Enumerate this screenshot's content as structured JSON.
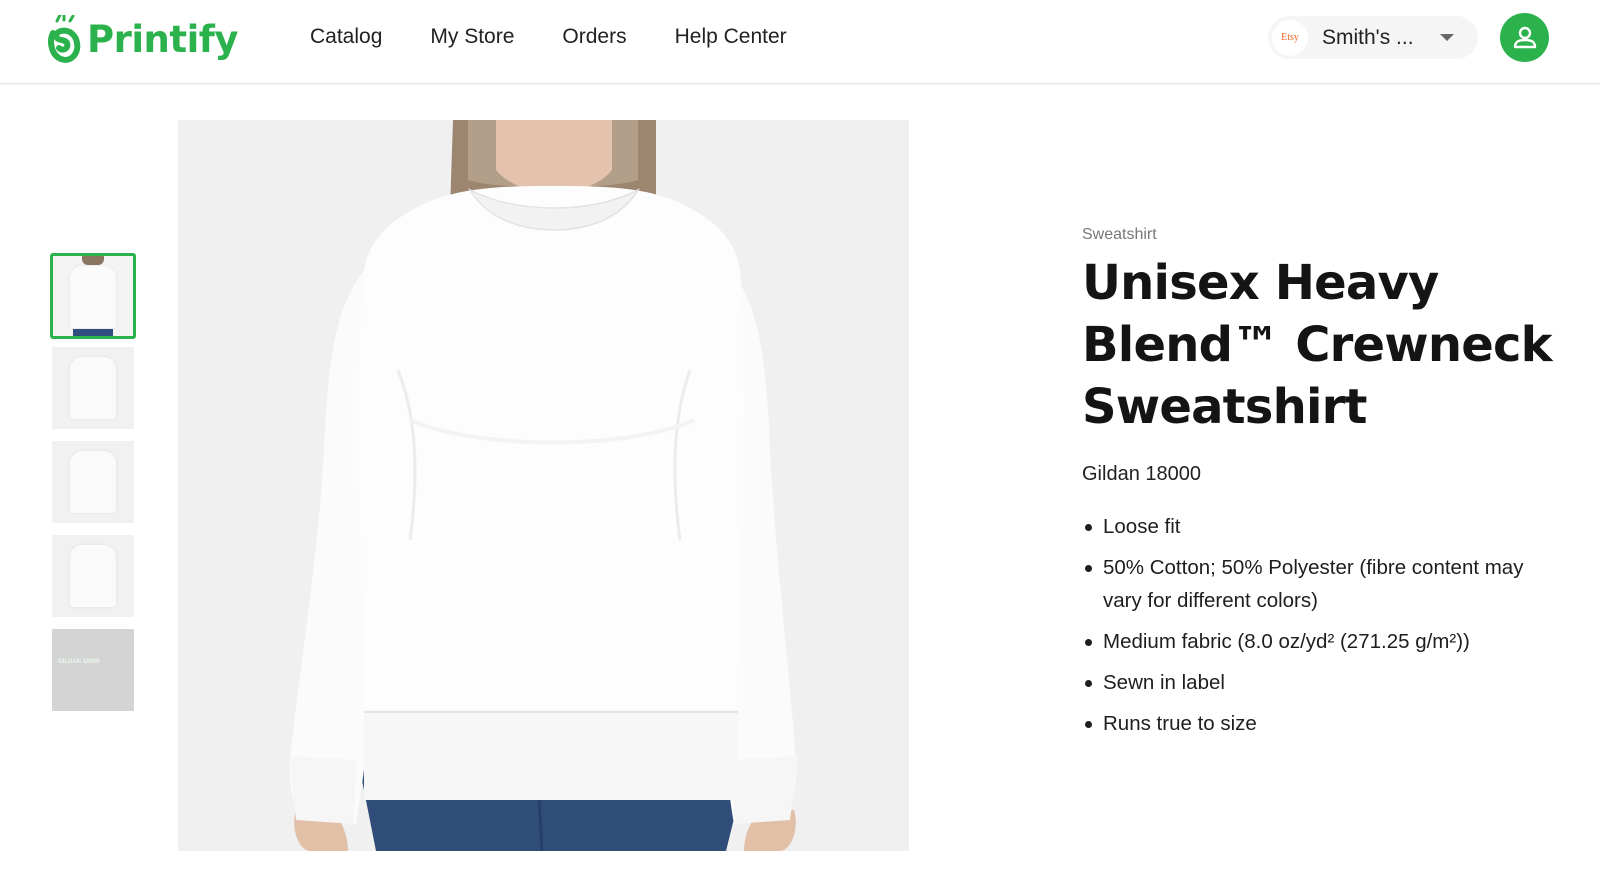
{
  "brand": {
    "name": "Printify",
    "color": "#2bb24c"
  },
  "nav": [
    {
      "label": "Catalog"
    },
    {
      "label": "My Store"
    },
    {
      "label": "Orders"
    },
    {
      "label": "Help Center"
    }
  ],
  "store": {
    "icon_text": "Etsy",
    "name": "Smith's ...",
    "icon": "chevron-down-icon"
  },
  "account": {
    "icon": "user-icon"
  },
  "gallery": {
    "selected_index": 0,
    "thumbnails": [
      {
        "kind": "model-front"
      },
      {
        "kind": "flat-front"
      },
      {
        "kind": "flat-back"
      },
      {
        "kind": "flat-side"
      },
      {
        "kind": "size-chart",
        "text": "GILDAN 18000"
      }
    ]
  },
  "product": {
    "category": "Sweatshirt",
    "title": "Unisex Heavy Blend™ Crewneck Sweatshirt",
    "model": "Gildan 18000",
    "features": [
      "Loose fit",
      "50% Cotton; 50% Polyester (fibre content may vary for different colors)",
      "Medium fabric (8.0 oz/yd² (271.25 g/m²))",
      "Sewn in label",
      "Runs true to size"
    ]
  }
}
